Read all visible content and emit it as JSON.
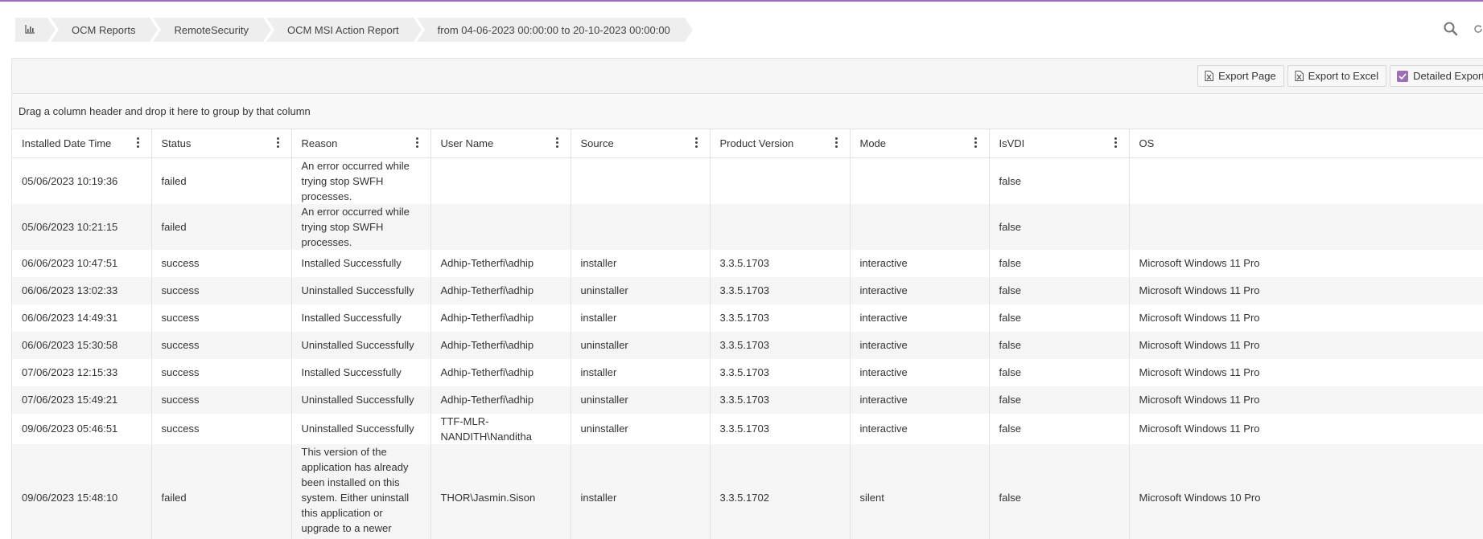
{
  "breadcrumb": {
    "home_icon": "bar-chart-icon",
    "items": [
      "OCM Reports",
      "RemoteSecurity",
      "OCM MSI Action Report",
      "from 04-06-2023 00:00:00 to 20-10-2023 00:00:00"
    ]
  },
  "top_icons": [
    "search-icon",
    "refresh-icon"
  ],
  "toolbar": {
    "export_page": "Export Page",
    "export_excel": "Export to Excel",
    "detailed_export": "Detailed Export",
    "detailed_export_checked": true
  },
  "grouping_hint": "Drag a column header and drop it here to group by that column",
  "columns": [
    "Installed Date Time",
    "Status",
    "Reason",
    "User Name",
    "Source",
    "Product Version",
    "Mode",
    "IsVDI",
    "OS"
  ],
  "rows": [
    [
      "05/06/2023 10:19:36",
      "failed",
      "An error occurred while trying stop SWFH processes.",
      "",
      "",
      "",
      "",
      "false",
      ""
    ],
    [
      "05/06/2023 10:21:15",
      "failed",
      "An error occurred while trying stop SWFH processes.",
      "",
      "",
      "",
      "",
      "false",
      ""
    ],
    [
      "06/06/2023 10:47:51",
      "success",
      "Installed Successfully",
      "Adhip-Tetherfi\\adhip",
      "installer",
      "3.3.5.1703",
      "interactive",
      "false",
      "Microsoft Windows 11 Pro"
    ],
    [
      "06/06/2023 13:02:33",
      "success",
      "Uninstalled Successfully",
      "Adhip-Tetherfi\\adhip",
      "uninstaller",
      "3.3.5.1703",
      "interactive",
      "false",
      "Microsoft Windows 11 Pro"
    ],
    [
      "06/06/2023 14:49:31",
      "success",
      "Installed Successfully",
      "Adhip-Tetherfi\\adhip",
      "installer",
      "3.3.5.1703",
      "interactive",
      "false",
      "Microsoft Windows 11 Pro"
    ],
    [
      "06/06/2023 15:30:58",
      "success",
      "Uninstalled Successfully",
      "Adhip-Tetherfi\\adhip",
      "uninstaller",
      "3.3.5.1703",
      "interactive",
      "false",
      "Microsoft Windows 11 Pro"
    ],
    [
      "07/06/2023 12:15:33",
      "success",
      "Installed Successfully",
      "Adhip-Tetherfi\\adhip",
      "installer",
      "3.3.5.1703",
      "interactive",
      "false",
      "Microsoft Windows 11 Pro"
    ],
    [
      "07/06/2023 15:49:21",
      "success",
      "Uninstalled Successfully",
      "Adhip-Tetherfi\\adhip",
      "uninstaller",
      "3.3.5.1703",
      "interactive",
      "false",
      "Microsoft Windows 11 Pro"
    ],
    [
      "09/06/2023 05:46:51",
      "success",
      "Uninstalled Successfully",
      "TTF-MLR-NANDITH\\Nanditha",
      "uninstaller",
      "3.3.5.1703",
      "interactive",
      "false",
      "Microsoft Windows 11 Pro"
    ],
    [
      "09/06/2023 15:48:10",
      "failed",
      "This version of the application has already been installed on this system. Either uninstall this application or upgrade to a newer version.",
      "THOR\\Jasmin.Sison",
      "installer",
      "3.3.5.1702",
      "silent",
      "false",
      "Microsoft Windows 10 Pro"
    ]
  ],
  "colors": {
    "accent": "#9b6fb3",
    "row_alt": "#f5f5f5",
    "border": "#e3e3e3"
  }
}
